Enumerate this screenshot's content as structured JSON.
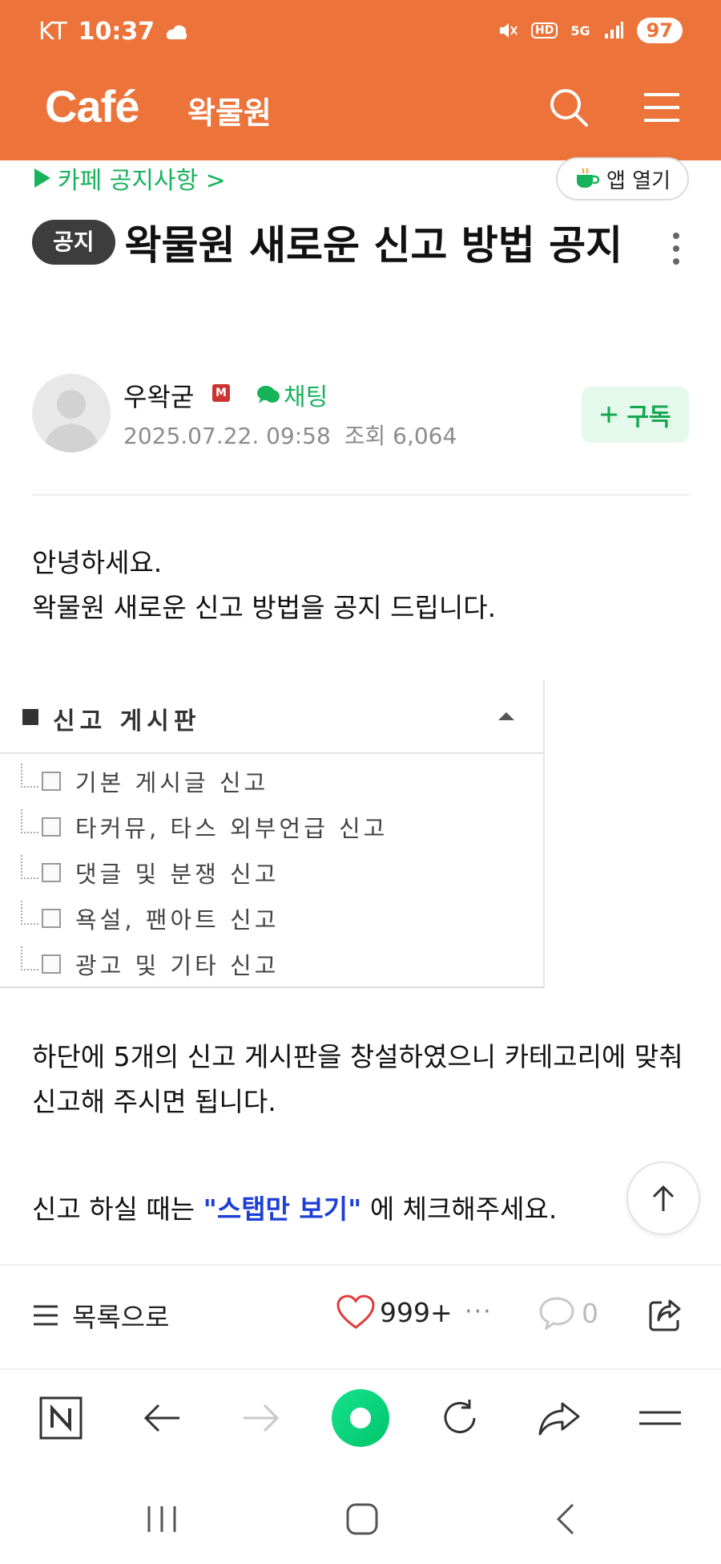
{
  "status_bar": {
    "carrier": "KT",
    "time": "10:37",
    "network": "5G",
    "battery": "97"
  },
  "app_header": {
    "logo": "Café",
    "cafe_name": "왁물원"
  },
  "notice_link": "카페 공지사항 >",
  "open_app_label": "앱 열기",
  "post": {
    "badge": "공지",
    "title": "왁물원 새로운 신고 방법 공지",
    "author": "우왁굳",
    "member_badge": "M",
    "chat_label": "채팅",
    "date": "2025.07.22. 09:58",
    "views": "조회 6,064",
    "subscribe_label": "구독",
    "intro_line1": "안녕하세요.",
    "intro_line2": "왁물원 새로운 신고 방법을 공지 드립니다.",
    "board": {
      "title": "신고 게시판",
      "items": [
        "기본 게시글 신고",
        "타커뮤, 타스 외부언급 신고",
        "댓글 및 분쟁 신고",
        "욕설, 팬아트 신고",
        "광고 및 기타 신고"
      ]
    },
    "paragraph2": "하단에 5개의 신고 게시판을 창설하였으니 카테고리에 맞춰 신고해 주시면 됩니다.",
    "p3_before": "신고 하실 때는 ",
    "p3_highlight": "\"스탭만 보기\"",
    "p3_after": " 에 체크해주세요."
  },
  "action_bar": {
    "list_label": "목록으로",
    "like_count": "999+",
    "more": "···",
    "comment_count": "0"
  },
  "colors": {
    "brand": "#ec733a",
    "green": "#17b35b",
    "link_blue": "#1d3fd6"
  },
  "icons": [
    "search-icon",
    "menu-icon",
    "more-vertical-icon",
    "chat-icon",
    "heart-icon",
    "comment-icon",
    "share-icon",
    "arrow-up-icon",
    "naver-n-icon",
    "back-arrow-icon",
    "forward-arrow-icon",
    "green-dot-icon",
    "refresh-icon",
    "share-arrow-icon",
    "hamburger-icon"
  ]
}
